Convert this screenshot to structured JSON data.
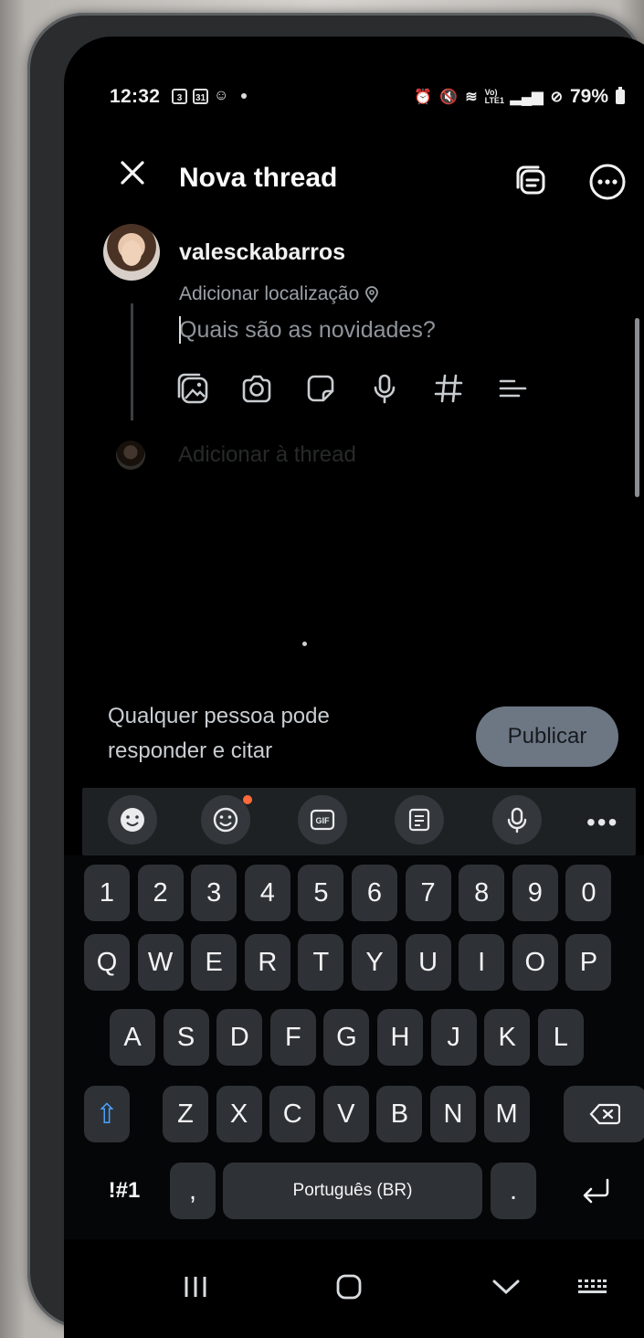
{
  "status_bar": {
    "time": "12:32",
    "calendar_day": "31",
    "badge_number": "3",
    "battery": "79%",
    "network_label": "Vo) LTE1"
  },
  "header": {
    "title": "Nova thread"
  },
  "post": {
    "username": "valesckabarros",
    "location_label": "Adicionar localização",
    "placeholder": "Quais são as novidades?",
    "add_to_thread": "Adicionar à thread",
    "gif_label": "GIF"
  },
  "footer": {
    "reply_permission": "Qualquer pessoa pode responder e citar",
    "publish_label": "Publicar"
  },
  "keyboard": {
    "toolbar_gif": "GIF",
    "toolbar_more": "•••",
    "number_row": [
      "1",
      "2",
      "3",
      "4",
      "5",
      "6",
      "7",
      "8",
      "9",
      "0"
    ],
    "row1": [
      "Q",
      "W",
      "E",
      "R",
      "T",
      "Y",
      "U",
      "I",
      "O",
      "P"
    ],
    "row2": [
      "A",
      "S",
      "D",
      "F",
      "G",
      "H",
      "J",
      "K",
      "L"
    ],
    "row3": [
      "Z",
      "X",
      "C",
      "V",
      "B",
      "N",
      "M"
    ],
    "symbols_label": "!#1",
    "comma": ",",
    "space_label": "Português (BR)",
    "period": "."
  },
  "colors": {
    "publish_bg": "#6d7784",
    "accent_blue": "#4aa3ff",
    "notification_dot": "#ff6a3d"
  }
}
